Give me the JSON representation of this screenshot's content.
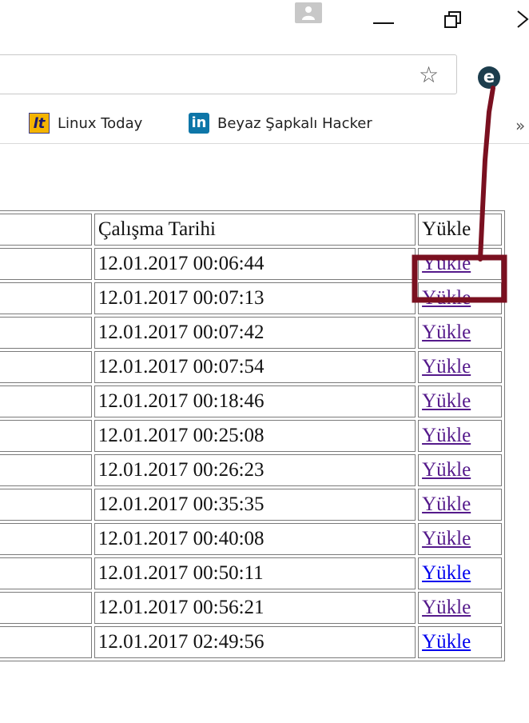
{
  "browser": {
    "bookmarks": [
      {
        "icon": "linux-today-icon",
        "icon_text": "lt",
        "label": "Linux Today"
      },
      {
        "icon": "linkedin-icon",
        "icon_text": "in",
        "label": "Beyaz Şapkalı Hacker"
      }
    ],
    "extension_icon": "e"
  },
  "table": {
    "headers": [
      "",
      "Çalışma Tarihi",
      "Yükle"
    ],
    "rows": [
      {
        "date": "12.01.2017 00:06:44",
        "link": "Yükle"
      },
      {
        "date": "12.01.2017 00:07:13",
        "link": "Yükle"
      },
      {
        "date": "12.01.2017 00:07:42",
        "link": "Yükle"
      },
      {
        "date": "12.01.2017 00:07:54",
        "link": "Yükle"
      },
      {
        "date": "12.01.2017 00:18:46",
        "link": "Yükle"
      },
      {
        "date": "12.01.2017 00:25:08",
        "link": "Yükle"
      },
      {
        "date": "12.01.2017 00:26:23",
        "link": "Yükle"
      },
      {
        "date": "12.01.2017 00:35:35",
        "link": "Yükle"
      },
      {
        "date": "12.01.2017 00:40:08",
        "link": "Yükle"
      },
      {
        "date": "12.01.2017 00:50:11",
        "link": "Yükle"
      },
      {
        "date": "12.01.2017 00:56:21",
        "link": "Yükle"
      },
      {
        "date": "12.01.2017 02:49:56",
        "link": "Yükle"
      }
    ]
  },
  "colors": {
    "visited_link": "#551a8b",
    "unvisited_link": "#0000ee",
    "annotation": "#7a1020"
  }
}
